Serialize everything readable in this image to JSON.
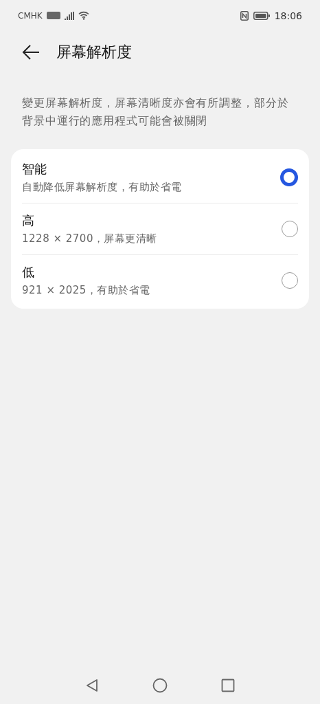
{
  "status_bar": {
    "carrier": "CMHK",
    "time": "18:06"
  },
  "header": {
    "title": "屏幕解析度"
  },
  "description": "變更屏幕解析度，屏幕清晰度亦會有所調整，部分於背景中運行的應用程式可能會被關閉",
  "options": [
    {
      "title": "智能",
      "subtitle": "自動降低屏幕解析度，有助於省電",
      "selected": true
    },
    {
      "title": "高",
      "subtitle": "1228 × 2700，屏幕更清晰",
      "selected": false
    },
    {
      "title": "低",
      "subtitle": "921 × 2025，有助於省電",
      "selected": false
    }
  ]
}
